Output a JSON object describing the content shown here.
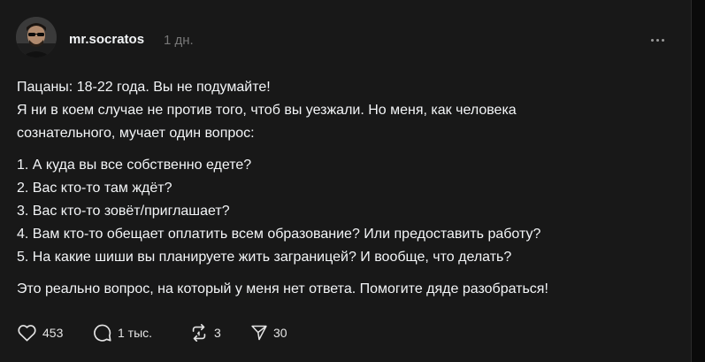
{
  "post": {
    "author": {
      "username": "mr.socratos",
      "avatar_icon": "avatar-man-with-sunglasses"
    },
    "time": "1 дн.",
    "more_icon": "more-dots-icon",
    "lines": [
      "Пацаны: 18-22 года. Вы не подумайте!",
      "Я ни в коем случае не против того, чтоб вы уезжали. Но меня, как человека",
      "сознательного, мучает один вопрос:"
    ],
    "list": [
      "1. А куда вы все собственно едете?",
      "2. Вас кто-то там ждёт?",
      "3. Вас кто-то зовёт/приглашает?",
      "4. Вам кто-то обещает оплатить всем образование? Или предоставить работу?",
      "5. На какие шиши вы планируете жить заграницей? И вообще, что делать?"
    ],
    "closing": "Это реально вопрос, на который у меня нет ответа. Помогите дяде разобраться!",
    "actions": {
      "likes": {
        "icon": "heart-icon",
        "count": "453"
      },
      "replies": {
        "icon": "comment-icon",
        "count": "1 тыс."
      },
      "reposts": {
        "icon": "repost-icon",
        "count": "3"
      },
      "shares": {
        "icon": "send-icon",
        "count": "30"
      }
    }
  },
  "colors": {
    "background": "#181818",
    "text": "#f3f5f7",
    "muted": "#777777"
  }
}
